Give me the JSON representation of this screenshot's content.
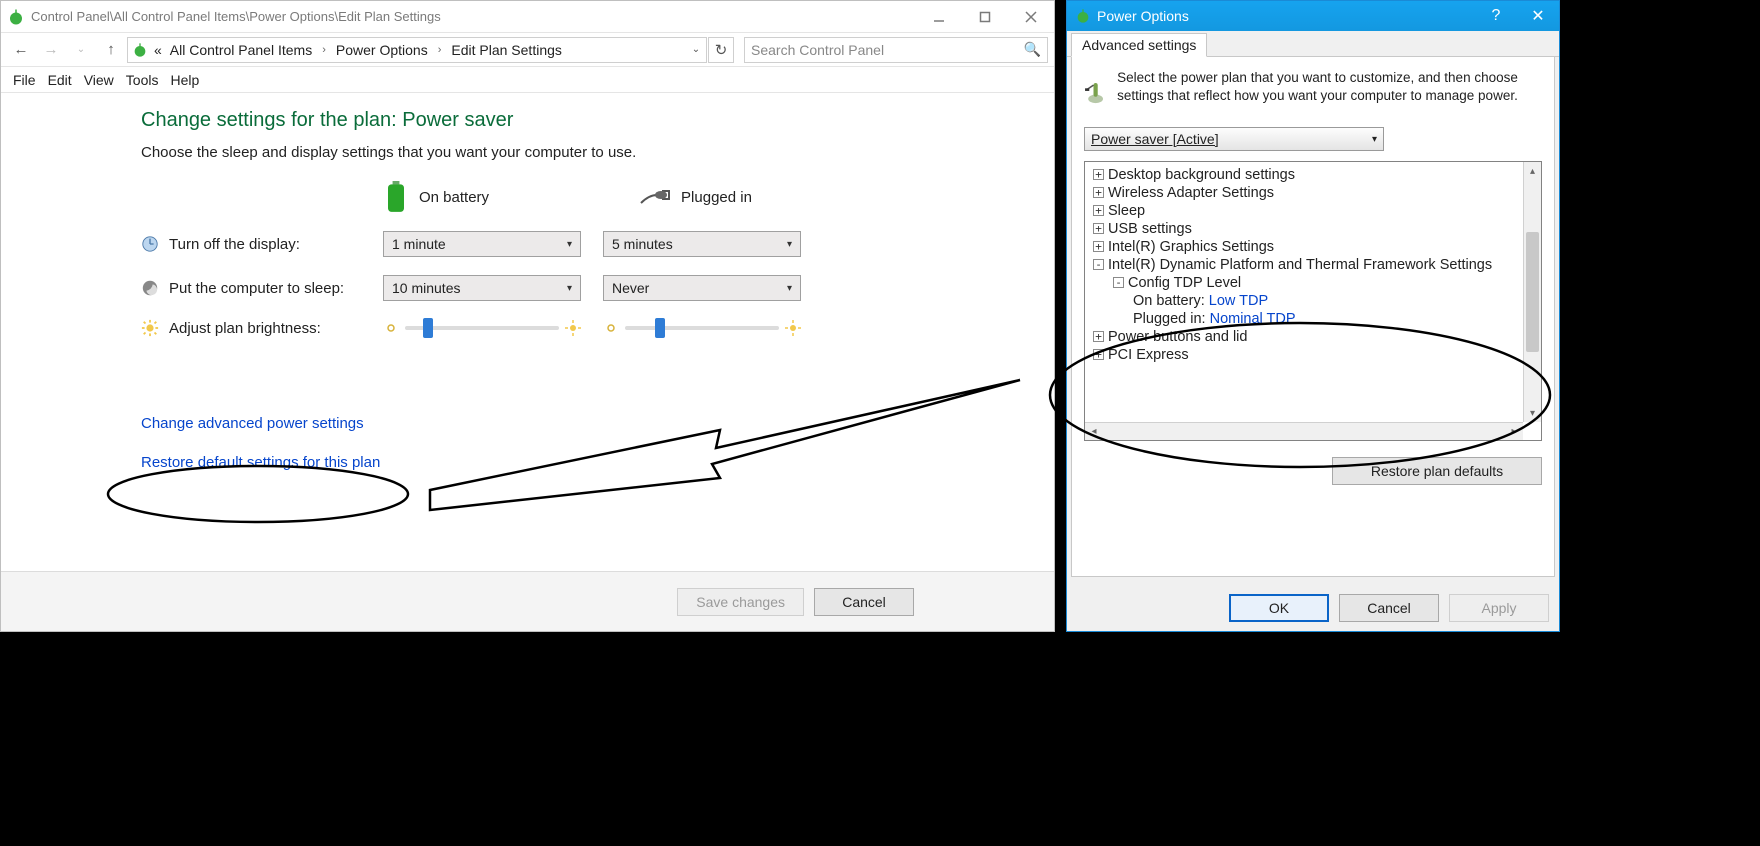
{
  "main": {
    "title": "Control Panel\\All Control Panel Items\\Power Options\\Edit Plan Settings",
    "breadcrumb": {
      "pre": "«",
      "c0": "All Control Panel Items",
      "c1": "Power Options",
      "c2": "Edit Plan Settings"
    },
    "search_placeholder": "Search Control Panel",
    "menus": {
      "file": "File",
      "edit": "Edit",
      "view": "View",
      "tools": "Tools",
      "help": "Help"
    },
    "page_title": "Change settings for the plan: Power saver",
    "subtext": "Choose the sleep and display settings that you want your computer to use.",
    "col_battery": "On battery",
    "col_plugged": "Plugged in",
    "rows": {
      "display": {
        "label": "Turn off the display:",
        "battery": "1 minute",
        "plugged": "5 minutes"
      },
      "sleep": {
        "label": "Put the computer to sleep:",
        "battery": "10 minutes",
        "plugged": "Never"
      },
      "brightness": {
        "label": "Adjust plan brightness:"
      }
    },
    "link_advanced": "Change advanced power settings",
    "link_restore": "Restore default settings for this plan",
    "btn_save": "Save changes",
    "btn_cancel": "Cancel"
  },
  "dlg": {
    "title": "Power Options",
    "tab": "Advanced settings",
    "description": "Select the power plan that you want to customize, and then choose settings that reflect how you want your computer to manage power.",
    "plan_selected": "Power saver [Active]",
    "tree": {
      "n0": "Desktop background settings",
      "n1": "Wireless Adapter Settings",
      "n2": "Sleep",
      "n3": "USB settings",
      "n4": "Intel(R) Graphics Settings",
      "n5": "Intel(R) Dynamic Platform and Thermal Framework Settings",
      "n5a": "Config TDP Level",
      "n5a_bat_lbl": "On battery:",
      "n5a_bat_val": "Low TDP",
      "n5a_plg_lbl": "Plugged in:",
      "n5a_plg_val": "Nominal TDP",
      "n6": "Power buttons and lid",
      "n7": "PCI Express"
    },
    "btn_restore": "Restore plan defaults",
    "btn_ok": "OK",
    "btn_cancel": "Cancel",
    "btn_apply": "Apply"
  }
}
